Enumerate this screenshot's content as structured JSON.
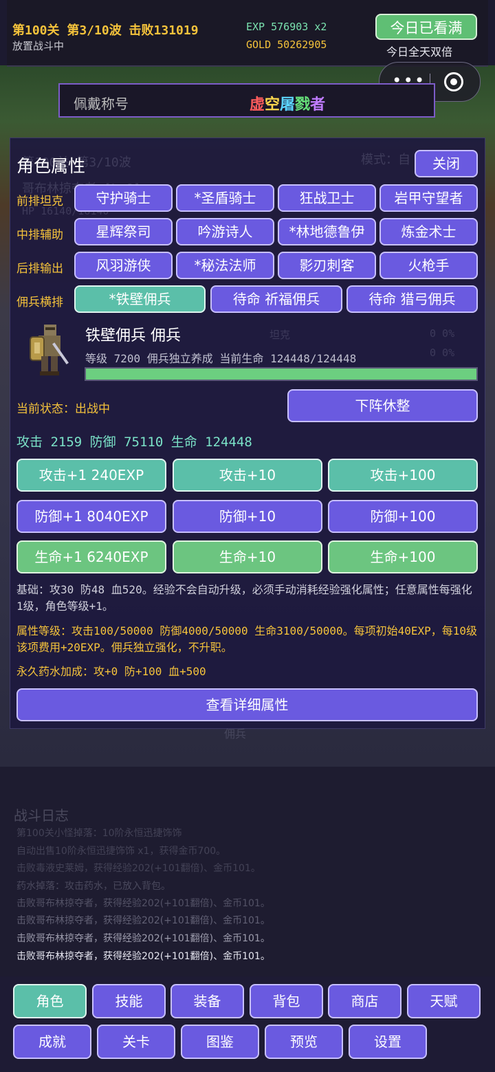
{
  "hud": {
    "level_text": "第100关 第3/10波 击败131019",
    "status": "放置战斗中",
    "exp": "EXP 576903 x2",
    "gold": "GOLD 50262905",
    "watch_button": "今日已看满",
    "double_text": "今日全天双倍"
  },
  "title_bar": {
    "label": "佩戴称号",
    "title_chars": [
      "虚",
      "空",
      "屠",
      "戮",
      "者"
    ],
    "title_colors": [
      "#ff5c5c",
      "#ffd84d",
      "#5cd4ff",
      "#66e07a",
      "#c07cff"
    ]
  },
  "background_ghost": {
    "wave": "第100关 第3/10波",
    "mode": "模式：自",
    "enemy": "哥布林掠夺者 [Lv8]",
    "hp": "HP 16140/16140",
    "tank": "坦克",
    "tank_val": "0  0%",
    "tank_val2": "0  0%",
    "mercenary": "佣兵"
  },
  "panel": {
    "title": "角色属性",
    "close": "关闭",
    "rows": [
      {
        "label": "前排坦克",
        "buttons": [
          "守护骑士",
          "*圣盾骑士",
          "狂战卫士",
          "岩甲守望者"
        ]
      },
      {
        "label": "中排辅助",
        "buttons": [
          "星辉祭司",
          "吟游诗人",
          "*林地德鲁伊",
          "炼金术士"
        ]
      },
      {
        "label": "后排输出",
        "buttons": [
          "风羽游侠",
          "*秘法法师",
          "影刃刺客",
          "火枪手"
        ]
      }
    ],
    "merc_row": {
      "label": "佣兵横排",
      "buttons": [
        "*铁壁佣兵",
        "待命 祈福佣兵",
        "待命 猎弓佣兵"
      ]
    },
    "merc": {
      "name": "铁壁佣兵  佣兵",
      "info": "等级 7200  佣兵独立养成  当前生命 124448/124448",
      "hp_fraction": 1.0
    },
    "state": "当前状态：出战中",
    "retire_button": "下阵休整",
    "stats": "攻击 2159  防御 75110  生命 124448",
    "upgrade_rows": [
      [
        "攻击+1 240EXP",
        "攻击+10",
        "攻击+100"
      ],
      [
        "防御+1 8040EXP",
        "防御+10",
        "防御+100"
      ],
      [
        "生命+1 6240EXP",
        "生命+10",
        "生命+100"
      ]
    ],
    "note_base": "基础：攻30 防48 血520。经验不会自动升级，必须手动消耗经验强化属性；任意属性每强化1级，角色等级+1。",
    "note_levels": "属性等级：攻击100/50000 防御4000/50000 生命3100/50000。每项初始40EXP，每10级该项费用+20EXP。佣兵独立强化，不升职。",
    "note_potion": "永久药水加成：攻+0 防+100 血+500",
    "detail_button": "查看详细属性"
  },
  "log": {
    "title": "战斗日志",
    "lines": [
      "第100关小怪掉落：10阶永恒迅捷饰饰",
      "自动出售10阶永恒迅捷饰饰 x1，获得金币700。",
      "击败毒液史莱姆，获得经验202(+101翻倍)、金币101。",
      "药水掉落：攻击药水，已放入背包。",
      "击败哥布林掠夺者，获得经验202(+101翻倍)、金币101。",
      "击败哥布林掠夺者，获得经验202(+101翻倍)、金币101。",
      "击败哥布林掠夺者，获得经验202(+101翻倍)、金币101。",
      "击败哥布林掠夺者，获得经验202(+101翻倍)、金币101。"
    ]
  },
  "nav": {
    "row1": [
      "角色",
      "技能",
      "装备",
      "背包",
      "商店",
      "天赋"
    ],
    "row2": [
      "成就",
      "关卡",
      "图鉴",
      "预览",
      "设置"
    ]
  }
}
